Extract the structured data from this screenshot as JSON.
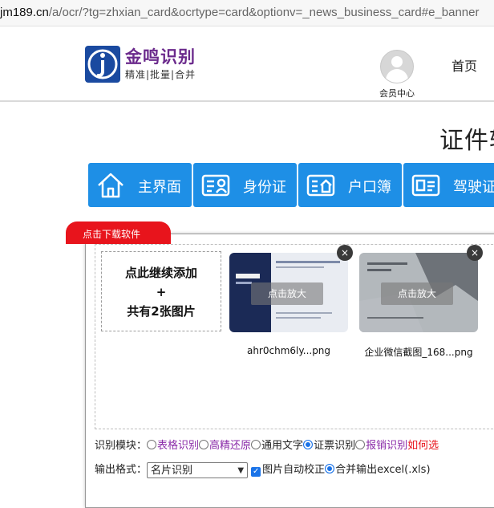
{
  "browser": {
    "url_domain": "jm189.cn",
    "url_path": "/a/ocr/?tg=zhxian_card&ocrtype=card&optionv=_news_business_card#e_banner"
  },
  "header": {
    "logo_title": "金鸣识别",
    "logo_tagline": "精准|批量|合并",
    "user_center_label": "会员中心",
    "nav_home": "首页"
  },
  "page_title": "证件转",
  "tabs": [
    {
      "label": "主界面",
      "icon": "home-icon"
    },
    {
      "label": "身份证",
      "icon": "id-card-icon"
    },
    {
      "label": "户口簿",
      "icon": "household-register-icon"
    },
    {
      "label": "驾驶证",
      "icon": "driver-license-icon"
    }
  ],
  "download_ribbon": "点击下载软件",
  "upload": {
    "add_line1": "点此继续添加",
    "add_line2": "+",
    "add_line3": "共有2张图片",
    "images": [
      {
        "zoom_label": "点击放大",
        "filename": "ahr0chm6ly...png",
        "close": "×"
      },
      {
        "zoom_label": "点击放大",
        "filename": "企业微信截图_168...png",
        "close": "×"
      }
    ]
  },
  "options": {
    "module_label": "识别模块：",
    "modules": [
      {
        "label": "表格识别",
        "selected": false,
        "style": "link"
      },
      {
        "label": "高精还原",
        "selected": false,
        "style": "link"
      },
      {
        "label": "通用文字",
        "selected": false,
        "style": "plain"
      },
      {
        "label": "证票识别",
        "selected": true,
        "style": "plain"
      },
      {
        "label": "报销识别",
        "selected": false,
        "style": "link"
      }
    ],
    "help_link": "如何选",
    "format_label": "输出格式：",
    "format_value": "名片识别",
    "auto_correct_label": "图片自动校正",
    "merge_label": "合并输出excel(.xls)"
  },
  "colors": {
    "tab_blue": "#1e8fe6",
    "ribbon_red": "#e8141c",
    "link_purple": "#8a2aa8",
    "help_red": "#e8141c",
    "logo_purple": "#6b2a8c"
  }
}
